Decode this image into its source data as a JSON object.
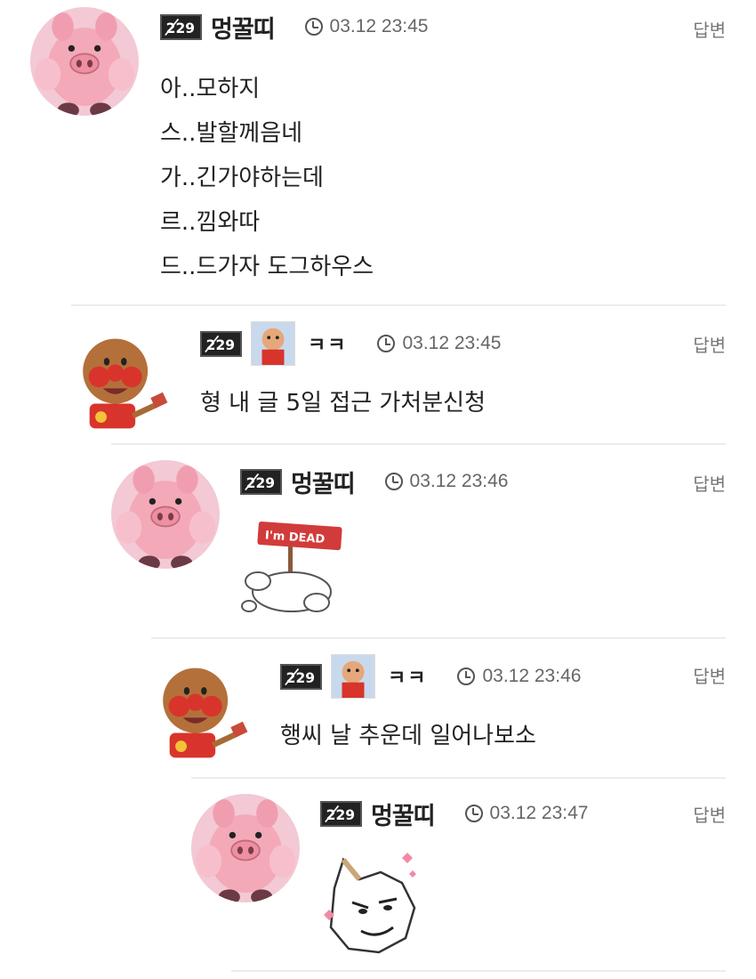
{
  "reply_label": "답변",
  "comments": [
    {
      "nick": "멍꿀띠",
      "time": "03.12 23:45",
      "lines": [
        "아..모하지",
        "스..발할께음네",
        "가..긴가야하는데",
        "르..낌와따",
        "드..드가자 도그하우스"
      ]
    },
    {
      "nick": "ㅋㅋ",
      "time": "03.12 23:45",
      "text": "형 내 글 5일 접근 가처분신청"
    },
    {
      "nick": "멍꿀띠",
      "time": "03.12 23:46",
      "emote_text": "I'm DEAD"
    },
    {
      "nick": "ㅋㅋ",
      "time": "03.12 23:46",
      "text": "행씨 날 추운데 일어나보소"
    },
    {
      "nick": "멍꿀띠",
      "time": "03.12 23:47"
    }
  ],
  "colors": {
    "pig_bg": "#f2c9d4",
    "pig_skin": "#f4a9b8",
    "anpan_face": "#b4703a",
    "anpan_cheek": "#d8342b",
    "divider": "#ececec"
  }
}
